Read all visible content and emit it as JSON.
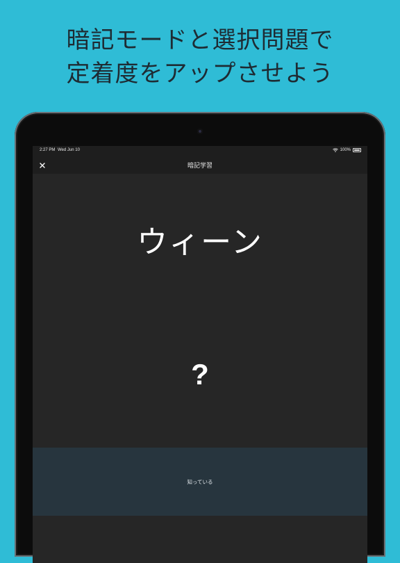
{
  "headline": {
    "line1": "暗記モードと選択問題で",
    "line2": "定着度をアップさせよう"
  },
  "status_bar": {
    "time": "2:27 PM",
    "date": "Wed Jun 10",
    "battery_text": "100%",
    "battery_level": 1.0,
    "icons": [
      "wifi-icon",
      "battery-icon"
    ]
  },
  "nav": {
    "title": "暗記学習",
    "close_icon": "close-icon"
  },
  "card": {
    "term": "ウィーン",
    "hidden_answer": "?"
  },
  "actions": {
    "know_label": "知っている"
  },
  "colors": {
    "background": "#2fbcd6",
    "screen": "#262626",
    "bar": "#1e1e1e",
    "button": "#27353e"
  }
}
